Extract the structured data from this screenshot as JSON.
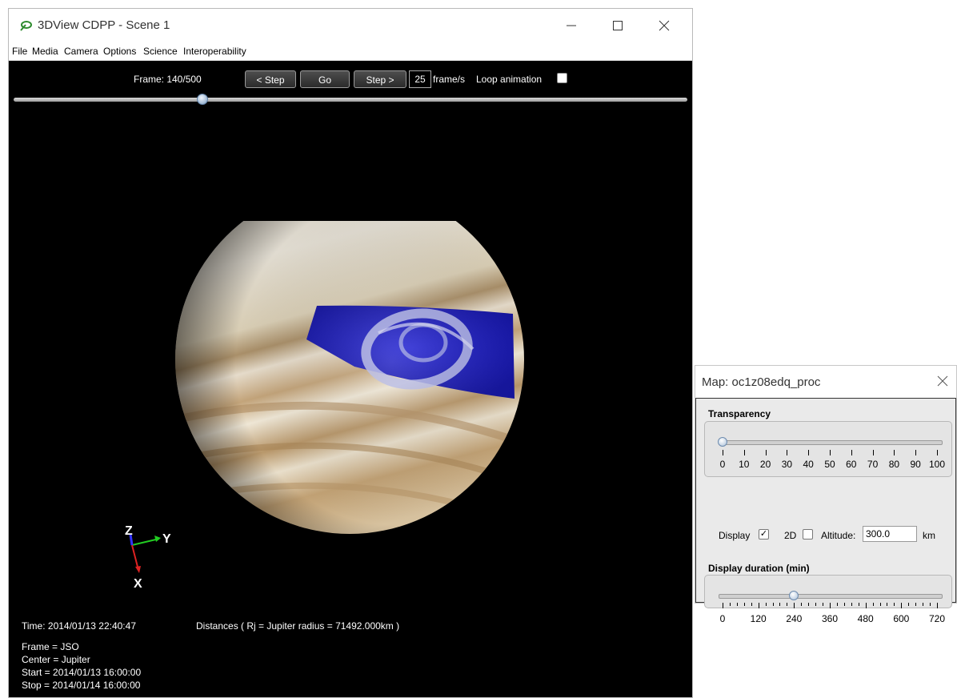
{
  "window": {
    "title": "3DView CDPP - Scene 1",
    "menu": [
      "File",
      "Media",
      "Camera",
      "Options",
      "Science",
      "Interoperability"
    ]
  },
  "toolbar": {
    "frame_label": "Frame: 140/500",
    "frame_current": 140,
    "frame_total": 500,
    "step_back_label": "< Step",
    "go_label": "Go",
    "step_forward_label": "Step >",
    "fps_value": "25",
    "fps_unit": "frame/s",
    "loop_label": "Loop animation",
    "loop_checked": false
  },
  "axes": {
    "z": "Z",
    "y": "Y",
    "x": "X"
  },
  "info": {
    "time": "Time: 2014/01/13 22:40:47",
    "distances": "Distances ( Rj = Jupiter radius = 71492.000km )",
    "frame": "Frame = JSO",
    "center": "Center = Jupiter",
    "start": "Start = 2014/01/13 16:00:00",
    "stop": "Stop = 2014/01/14 16:00:00"
  },
  "map_window": {
    "title": "Map: oc1z08edq_proc",
    "transparency": {
      "label": "Transparency",
      "value": 0,
      "ticks": [
        "0",
        "10",
        "20",
        "30",
        "40",
        "50",
        "60",
        "70",
        "80",
        "90",
        "100"
      ]
    },
    "display_label": "Display",
    "display_checked": true,
    "twod_label": "2D",
    "twod_checked": false,
    "altitude_label": "Altitude:",
    "altitude_value": "300.0",
    "altitude_unit": "km",
    "duration": {
      "label": "Display duration (min)",
      "value": 240,
      "max": 720,
      "ticks": [
        "0",
        "120",
        "240",
        "360",
        "480",
        "600",
        "720"
      ]
    }
  },
  "colors": {
    "aurora": "#1a1acc",
    "background": "#000000"
  }
}
